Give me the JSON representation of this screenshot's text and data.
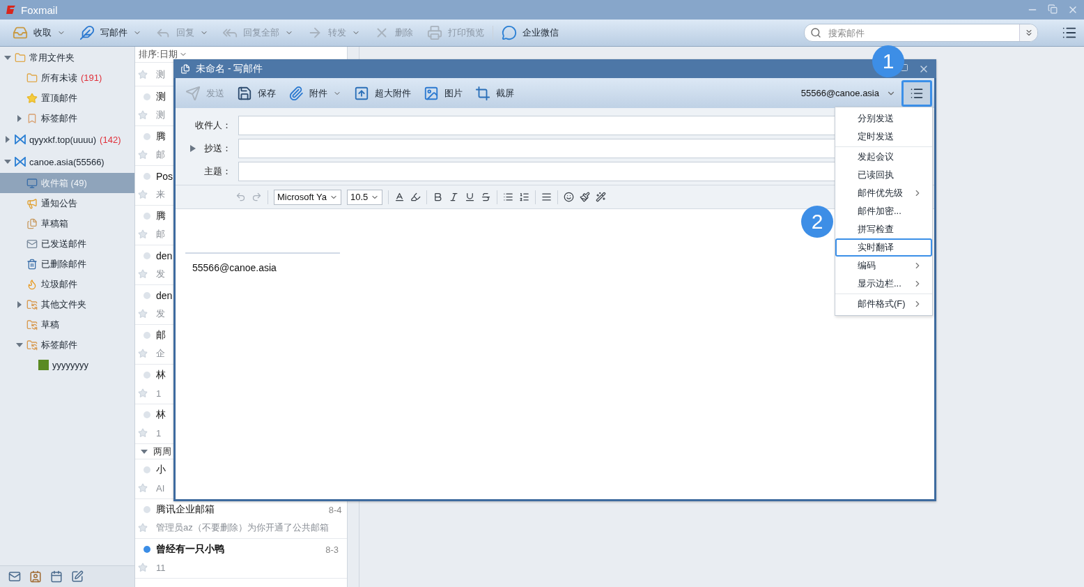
{
  "app": {
    "title": "Foxmail"
  },
  "toolbar": [
    {
      "kind": "receive",
      "label": "收取",
      "dropdown": true,
      "disabled": false
    },
    {
      "kind": "compose",
      "label": "写邮件",
      "dropdown": true,
      "disabled": false
    },
    {
      "kind": "reply",
      "label": "回复",
      "dropdown": true,
      "disabled": true
    },
    {
      "kind": "reply-all",
      "label": "回复全部",
      "dropdown": true,
      "disabled": true
    },
    {
      "kind": "forward",
      "label": "转发",
      "dropdown": true,
      "disabled": true
    },
    {
      "kind": "delete",
      "label": "删除",
      "dropdown": false,
      "disabled": true
    },
    {
      "kind": "print",
      "label": "打印预览",
      "dropdown": false,
      "disabled": true
    },
    {
      "kind": "wecom",
      "label": "企业微信",
      "dropdown": false,
      "disabled": false
    }
  ],
  "search": {
    "placeholder": "搜索邮件"
  },
  "sidebar": {
    "items": [
      {
        "kind": "folder",
        "label": "常用文件夹",
        "expanded": true,
        "selected": false,
        "children": [
          {
            "kind": "folder",
            "label": "所有未读",
            "count": "(191)",
            "selected": false
          },
          {
            "kind": "star",
            "label": "置顶邮件",
            "selected": false
          },
          {
            "kind": "tag",
            "label": "标签邮件",
            "expanded": false,
            "selected": false
          }
        ]
      },
      {
        "kind": "account",
        "label": "qyyxkf.top(uuuu)",
        "count": "(142)",
        "expanded": false,
        "selected": false
      },
      {
        "kind": "account",
        "label": "canoe.asia(55566)",
        "expanded": true,
        "selected": false,
        "children": [
          {
            "kind": "inbox",
            "label": "收件箱 (49)",
            "selected": true
          },
          {
            "kind": "notice",
            "label": "通知公告",
            "selected": false
          },
          {
            "kind": "drafts",
            "label": "草稿箱",
            "selected": false
          },
          {
            "kind": "sent",
            "label": "已发送邮件",
            "selected": false
          },
          {
            "kind": "trash",
            "label": "已删除邮件",
            "selected": false
          },
          {
            "kind": "junk",
            "label": "垃圾邮件",
            "selected": false
          },
          {
            "kind": "sync",
            "label": "其他文件夹",
            "expanded": false,
            "selected": false
          },
          {
            "kind": "sync",
            "label": "草稿",
            "selected": false
          },
          {
            "kind": "sync",
            "label": "标签邮件",
            "expanded": true,
            "selected": false,
            "children": [
              {
                "kind": "label",
                "label": "yyyyyyyy",
                "color": "#5a8a22",
                "selected": false
              }
            ]
          }
        ]
      }
    ]
  },
  "message_list": {
    "sort": "排序:日期",
    "rows": [
      {
        "kind": "partial",
        "preview": "测"
      },
      {
        "kind": "message",
        "title": "测",
        "preview": "测",
        "unread": false
      },
      {
        "kind": "message",
        "title": "腾",
        "preview": "邮",
        "unread": false
      },
      {
        "kind": "message",
        "title": "Pos",
        "preview": "来",
        "unread": false
      },
      {
        "kind": "message",
        "title": "腾",
        "preview": "邮",
        "unread": false
      },
      {
        "kind": "message",
        "title": "den",
        "preview": "发",
        "unread": false
      },
      {
        "kind": "message",
        "title": "den",
        "preview": "发",
        "unread": false
      },
      {
        "kind": "message",
        "title": "邮",
        "preview": "企",
        "unread": false
      },
      {
        "kind": "message",
        "title": "林",
        "preview": "1",
        "unread": false
      },
      {
        "kind": "message",
        "title": "林",
        "preview": "1",
        "unread": false
      },
      {
        "kind": "group",
        "title": "两周",
        "expanded": true
      },
      {
        "kind": "message",
        "title": "小",
        "preview": "AI",
        "unread": false
      },
      {
        "kind": "message",
        "title": "腾讯企业邮箱",
        "preview": "管理员az（不要删除）为你开通了公共邮箱",
        "date": "8-4",
        "unread": false
      },
      {
        "kind": "message",
        "title": "曾经有一只小鸭",
        "preview": "11",
        "date": "8-3",
        "unread": true
      }
    ]
  },
  "compose": {
    "title": "未命名 - 写邮件",
    "toolbar": [
      {
        "kind": "send",
        "label": "发送",
        "dropdown": false,
        "disabled": true
      },
      {
        "kind": "save",
        "label": "保存",
        "dropdown": false,
        "disabled": false
      },
      {
        "kind": "attach",
        "label": "附件",
        "dropdown": true,
        "disabled": false
      },
      {
        "kind": "big-attach",
        "label": "超大附件",
        "dropdown": false,
        "disabled": false
      },
      {
        "kind": "image",
        "label": "图片",
        "dropdown": false,
        "disabled": false
      },
      {
        "kind": "screenshot",
        "label": "截屏",
        "dropdown": false,
        "disabled": false
      }
    ],
    "account": "55566@canoe.asia",
    "menu_button": {
      "outlined": true
    },
    "fields": [
      {
        "label": "收件人：",
        "expandable": false
      },
      {
        "label": "抄送：",
        "expandable": true
      },
      {
        "label": "主题：",
        "expandable": false
      }
    ],
    "format": {
      "font": "Microsoft Ya",
      "size": "10.5"
    },
    "signature": "55566@canoe.asia",
    "menu": [
      [
        {
          "label": "分别发送",
          "submenu": false,
          "outlined": false
        },
        {
          "label": "定时发送",
          "submenu": false,
          "outlined": false
        }
      ],
      [
        {
          "label": "发起会议",
          "submenu": false,
          "outlined": false
        },
        {
          "label": "已读回执",
          "submenu": false,
          "outlined": false
        },
        {
          "label": "邮件优先级",
          "submenu": true,
          "outlined": false
        },
        {
          "label": "邮件加密...",
          "submenu": false,
          "outlined": false
        },
        {
          "label": "拼写检查",
          "submenu": false,
          "outlined": false
        },
        {
          "label": "实时翻译",
          "submenu": false,
          "outlined": true
        },
        {
          "label": "编码",
          "submenu": true,
          "outlined": false
        },
        {
          "label": "显示边栏...",
          "submenu": true,
          "outlined": false
        }
      ],
      [
        {
          "label": "邮件格式(F)",
          "submenu": true,
          "outlined": false
        }
      ]
    ]
  },
  "annotations": [
    {
      "label": "1"
    },
    {
      "label": "2"
    }
  ]
}
